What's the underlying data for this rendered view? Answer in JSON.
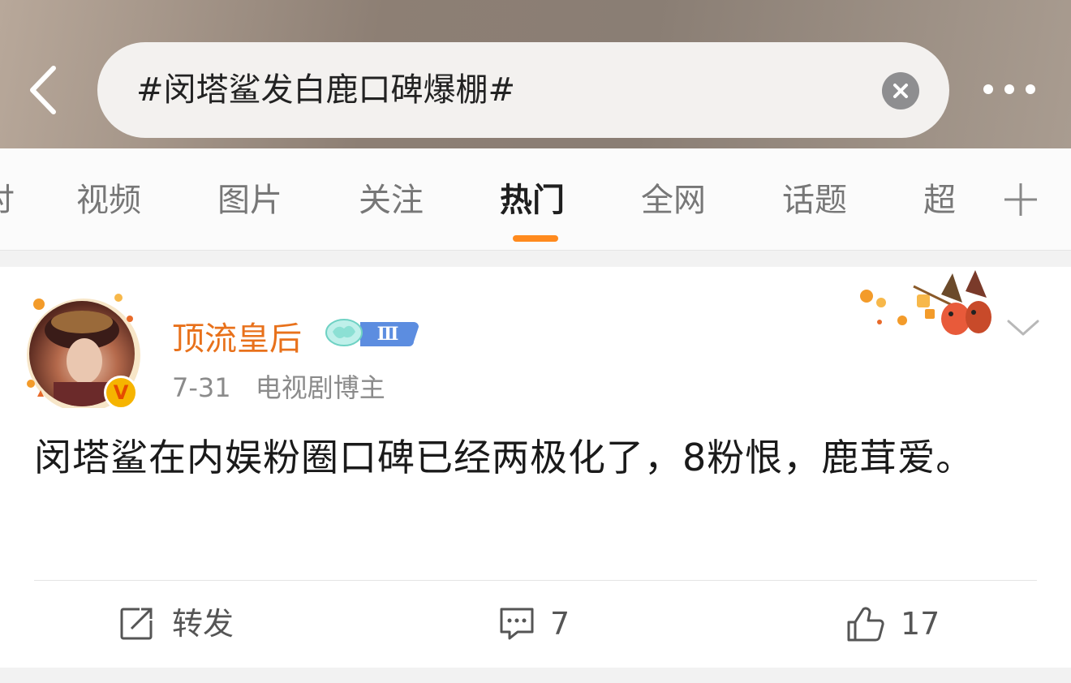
{
  "header": {
    "search_query": "#闵塔鲨发白鹿口碑爆棚#",
    "back_icon": "chevron-left-icon",
    "clear_icon": "clear-icon",
    "more_icon": "more-horizontal-icon"
  },
  "tabs": {
    "items": [
      {
        "label": "讨"
      },
      {
        "label": "视频"
      },
      {
        "label": "图片"
      },
      {
        "label": "关注"
      },
      {
        "label": "热门"
      },
      {
        "label": "全网"
      },
      {
        "label": "话题"
      },
      {
        "label": "超"
      }
    ],
    "active_label": "热门",
    "accent_color": "#ff8a1e",
    "add_icon": "plus-icon"
  },
  "post": {
    "username": "顶流皇后",
    "username_color": "#e8711b",
    "level_badge": "Ⅲ",
    "verified_mark": "V",
    "date": "7-31",
    "source": "电视剧博主",
    "text": "闵塔鲨在内娱粉圈口碑已经两极化了，8粉恨，鹿茸爱。",
    "actions": {
      "repost_label": "转发",
      "comment_count": "7",
      "like_count": "17"
    }
  }
}
